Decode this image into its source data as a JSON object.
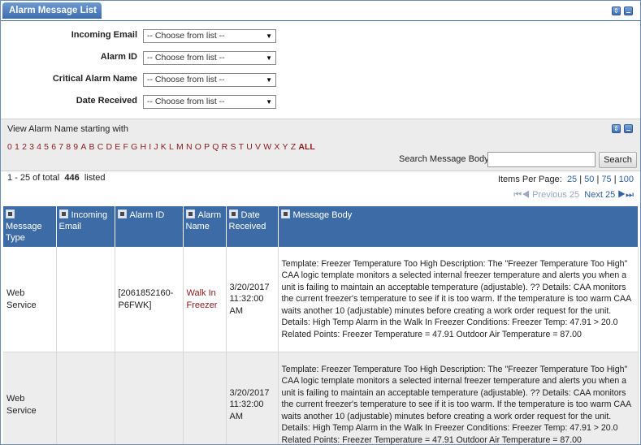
{
  "panel": {
    "title": "Alarm Message List"
  },
  "filters": [
    {
      "label": "Incoming Email",
      "value": "-- Choose from list --"
    },
    {
      "label": "Alarm ID",
      "value": "-- Choose from list --"
    },
    {
      "label": "Critical Alarm Name",
      "value": "-- Choose from list --"
    },
    {
      "label": "Date Received",
      "value": "-- Choose from list --"
    }
  ],
  "alpha": {
    "title": "View Alarm Name starting with",
    "letters": [
      "0",
      "1",
      "2",
      "3",
      "4",
      "5",
      "6",
      "7",
      "8",
      "9",
      "A",
      "B",
      "C",
      "D",
      "E",
      "F",
      "G",
      "H",
      "I",
      "J",
      "K",
      "L",
      "M",
      "N",
      "O",
      "P",
      "Q",
      "R",
      "S",
      "T",
      "U",
      "V",
      "W",
      "X",
      "Y",
      "Z"
    ],
    "all_label": "ALL",
    "search_label": "Search Message Body",
    "search_value": "",
    "search_button": "Search"
  },
  "paging": {
    "range": "1 - 25 of total",
    "total": "446",
    "listed": "listed",
    "items_per_page_label": "Items Per Page:",
    "sizes": [
      "25",
      "50",
      "75",
      "100"
    ],
    "previous": "Previous 25",
    "next": "Next 25"
  },
  "table": {
    "headers": [
      "Message Type",
      "Incoming Email",
      "Alarm ID",
      "Alarm Name",
      "Date Received",
      "Message Body"
    ],
    "rows": [
      {
        "type": "Web Service",
        "email": "",
        "alarm_id": "[2061852160-P6FWK]",
        "alarm_name": "Walk In Freezer",
        "date": "3/20/2017 11:32:00 AM",
        "body": "Template: Freezer Temperature Too High Description: The \"Freezer Temperature Too High\" CAA logic template monitors a selected internal freezer temperature and alerts you when a unit is failing to maintain an acceptable temperature (adjustable). ?? Details: CAA monitors the current freezer's temperature to see if it is too warm. If the temperature is too warm CAA waits another 10 (adjustable) minutes before creating a work order request for the unit. Details: High Temp Alarm in the Walk In Freezer Conditions: Freezer Temp: 47.91 > 20.0 Related Points: Freezer Temperature = 47.91 Outdoor Air Temperature = 87.00"
      },
      {
        "type": "Web Service",
        "email": "",
        "alarm_id": "",
        "alarm_name": "",
        "date": "3/20/2017 11:32:00 AM",
        "body": "Template: Freezer Temperature Too High Description: The \"Freezer Temperature Too High\" CAA logic template monitors a selected internal freezer temperature and alerts you when a unit is failing to maintain an acceptable temperature (adjustable). ?? Details: CAA monitors the current freezer's temperature to see if it is too warm. If the temperature is too warm CAA waits another 10 (adjustable) minutes before creating a work order request for the unit. Details: High Temp Alarm in the Walk In Freezer Conditions: Freezer Temp: 47.91 > 20.0 Related Points: Freezer Temperature = 47.91 Outdoor Air Temperature = 87.00"
      }
    ]
  }
}
